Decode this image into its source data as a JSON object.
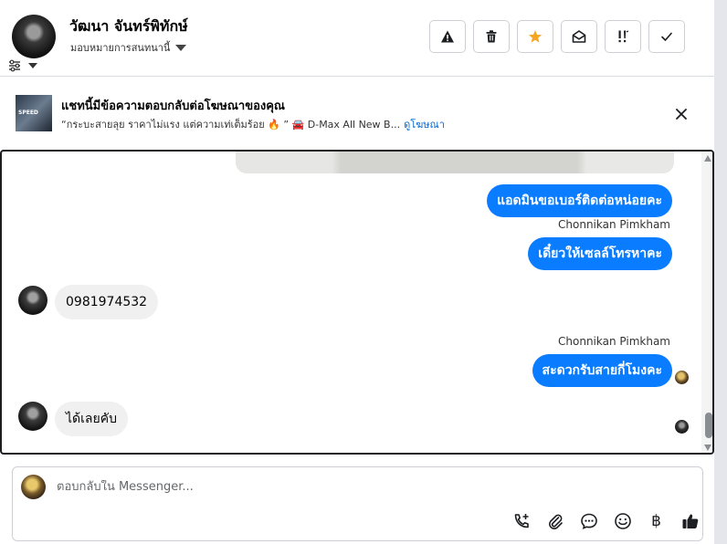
{
  "header": {
    "contact_name": "วัฒนา จันทร์พิทักษ์",
    "assign_label": "มอบหมายการสนทนานี้",
    "toolbar": [
      {
        "name": "mark-spam-button",
        "icon": "warning-icon"
      },
      {
        "name": "delete-button",
        "icon": "trash-icon"
      },
      {
        "name": "star-button",
        "icon": "star-icon"
      },
      {
        "name": "mark-unread-button",
        "icon": "envelope-open-icon"
      },
      {
        "name": "follow-up-button",
        "icon": "priority-icon"
      },
      {
        "name": "mark-done-button",
        "icon": "check-icon"
      }
    ]
  },
  "banner": {
    "title": "แชทนี้มีข้อความตอบกลับต่อโฆษณาของคุณ",
    "thumb_text": "SPEED",
    "ad_text": "“กระบะสายลุย ราคาไม่แรง แต่ความเท่เต็มร้อย 🔥 ” 🚘 D-Max All New B...",
    "link": "ดูโฆษณา"
  },
  "messages": [
    {
      "direction": "out",
      "text": "แอดมินขอเบอร์ติดต่อหน่อยคะ"
    },
    {
      "direction": "out",
      "sender": "Chonnikan Pimkham",
      "text": "เดี๋ยวให้เซลล์โทรหาคะ"
    },
    {
      "direction": "in",
      "text": "0981974532"
    },
    {
      "direction": "out",
      "sender": "Chonnikan Pimkham",
      "text": "สะดวกรับสายกี่โมงคะ"
    },
    {
      "direction": "in",
      "text": "ได้เลยคับ"
    }
  ],
  "composer": {
    "placeholder": "ตอบกลับใน Messenger..."
  },
  "tools": [
    {
      "name": "call-add-icon"
    },
    {
      "name": "attach-icon"
    },
    {
      "name": "saved-reply-icon"
    },
    {
      "name": "emoji-icon"
    },
    {
      "name": "payment-icon",
      "glyph": "฿"
    },
    {
      "name": "thumbs-up-icon"
    }
  ],
  "colors": {
    "bubble_out": "#0a7cff",
    "bubble_in": "#f0f0f0",
    "star": "#f5a623",
    "link": "#0064d1"
  }
}
